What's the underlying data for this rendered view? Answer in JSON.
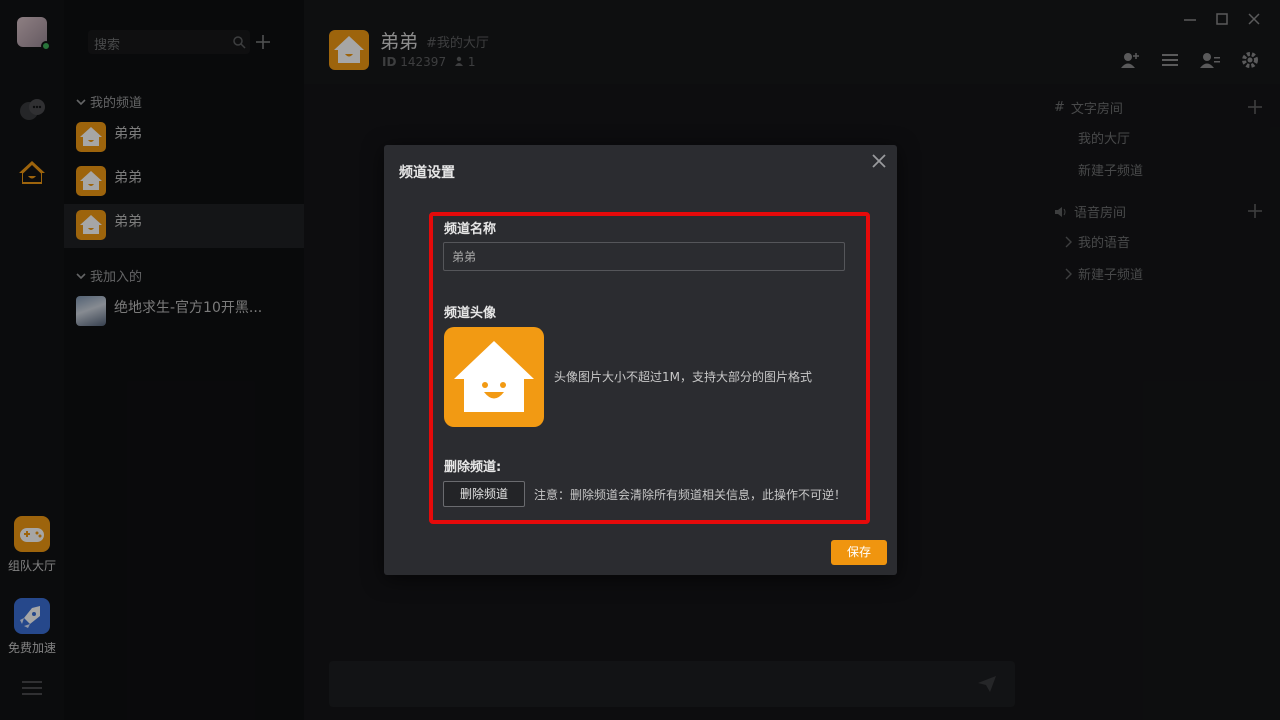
{
  "sidebar": {
    "search_placeholder": "搜索",
    "sections": [
      {
        "label": "我的频道",
        "channels": [
          "弟弟",
          "弟弟",
          "弟弟"
        ]
      },
      {
        "label": "我加入的",
        "channels": [
          "绝地求生-官方10开黑..."
        ]
      }
    ],
    "apps": [
      {
        "label": "组队大厅",
        "color": "#f29a13"
      },
      {
        "label": "免费加速",
        "color": "#3b6fd6"
      }
    ]
  },
  "header": {
    "title": "弟弟",
    "subtitle": "#我的大厅",
    "id_label": "ID",
    "id_value": "142397",
    "member_count": "1"
  },
  "right_panel": {
    "text_rooms": {
      "label": "文字房间",
      "items": [
        "我的大厅",
        "新建子频道"
      ]
    },
    "voice_rooms": {
      "label": "语音房间",
      "items": [
        "我的语音",
        "新建子频道"
      ]
    }
  },
  "modal": {
    "title": "频道设置",
    "name_label": "频道名称",
    "name_value": "弟弟",
    "avatar_label": "频道头像",
    "avatar_hint": "头像图片大小不超过1M，支持大部分的图片格式",
    "delete_label": "删除频道:",
    "delete_button": "删除频道",
    "delete_note": "注意：删除频道会清除所有频道相关信息，此操作不可逆！",
    "save_button": "保存"
  },
  "colors": {
    "accent": "#f29a13",
    "highlight": "#e50a0a"
  }
}
